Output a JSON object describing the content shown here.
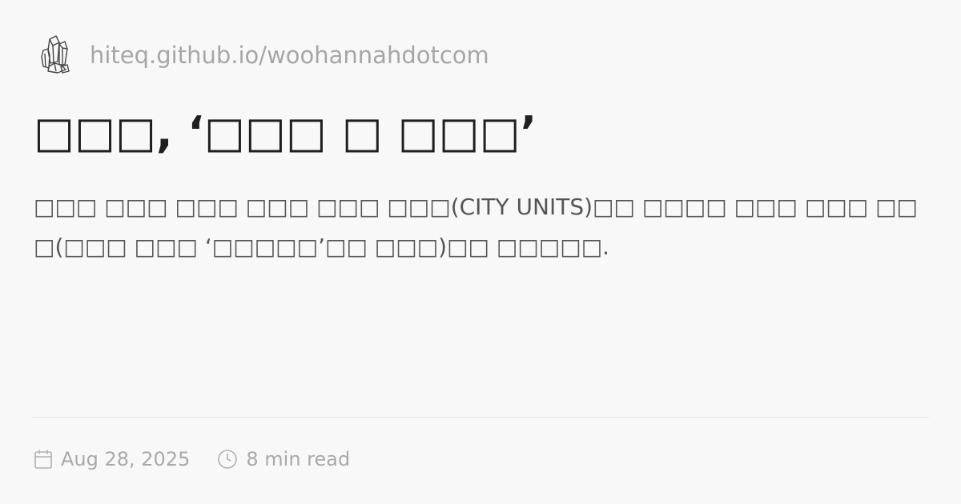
{
  "header": {
    "logo_icon": "crystal-cluster-icon",
    "site_url": "hiteq.github.io/woohannahdotcom"
  },
  "article": {
    "title": "□□□, ‘□□□ □ □□□’",
    "description": "□□□ □□□ □□□ □□□ □□□ □□□(CITY UNITS)□□ □□□□ □□□ □□□ □□□(□□□ □□□ ‘□□□□□’□□ □□□)□□ □□□□□."
  },
  "meta": {
    "date_icon": "calendar-icon",
    "date": "Aug 28, 2025",
    "read_icon": "clock-icon",
    "read_time": "8 min read"
  },
  "colors": {
    "background": "#f9f8f9",
    "title": "#1f1f1f",
    "description": "#555555",
    "muted": "#a6a5a8",
    "divider": "#e4e3e6"
  }
}
